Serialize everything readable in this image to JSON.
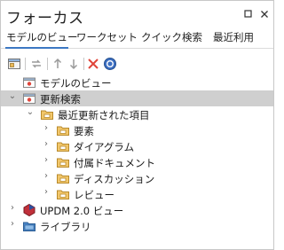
{
  "window": {
    "title": "フォーカス"
  },
  "tabs": [
    "モデルのビュー",
    "ワークセット",
    "クイック検索",
    "最近利用"
  ],
  "active_tab": 0,
  "colors": {
    "accent": "#3c78c3",
    "selected_row": "#cfcfcf",
    "folder": "#e9b85a",
    "delete": "#e0453a"
  },
  "toolbar": [
    "properties-icon",
    "sync-icon",
    "move-up-icon",
    "move-down-icon",
    "delete-icon",
    "help-icon"
  ],
  "tree": [
    {
      "label": "モデルのビュー",
      "level": 0,
      "expander": "none",
      "icon": "view-icon"
    },
    {
      "label": "更新検索",
      "level": 0,
      "expander": "open",
      "icon": "search-view-icon",
      "selected": true
    },
    {
      "label": "最近更新された項目",
      "level": 1,
      "expander": "open",
      "icon": "folder-icon"
    },
    {
      "label": "要素",
      "level": 2,
      "expander": "closed",
      "icon": "folder-icon"
    },
    {
      "label": "ダイアグラム",
      "level": 2,
      "expander": "closed",
      "icon": "folder-icon"
    },
    {
      "label": "付属ドキュメント",
      "level": 2,
      "expander": "closed",
      "icon": "folder-icon"
    },
    {
      "label": "ディスカッション",
      "level": 2,
      "expander": "closed",
      "icon": "folder-icon"
    },
    {
      "label": "レビュー",
      "level": 2,
      "expander": "closed",
      "icon": "folder-icon"
    },
    {
      "label": "UPDM 2.0 ビュー",
      "level": 0,
      "expander": "closed",
      "icon": "updm-icon"
    },
    {
      "label": "ライブラリ",
      "level": 0,
      "expander": "closed",
      "icon": "library-icon"
    }
  ]
}
